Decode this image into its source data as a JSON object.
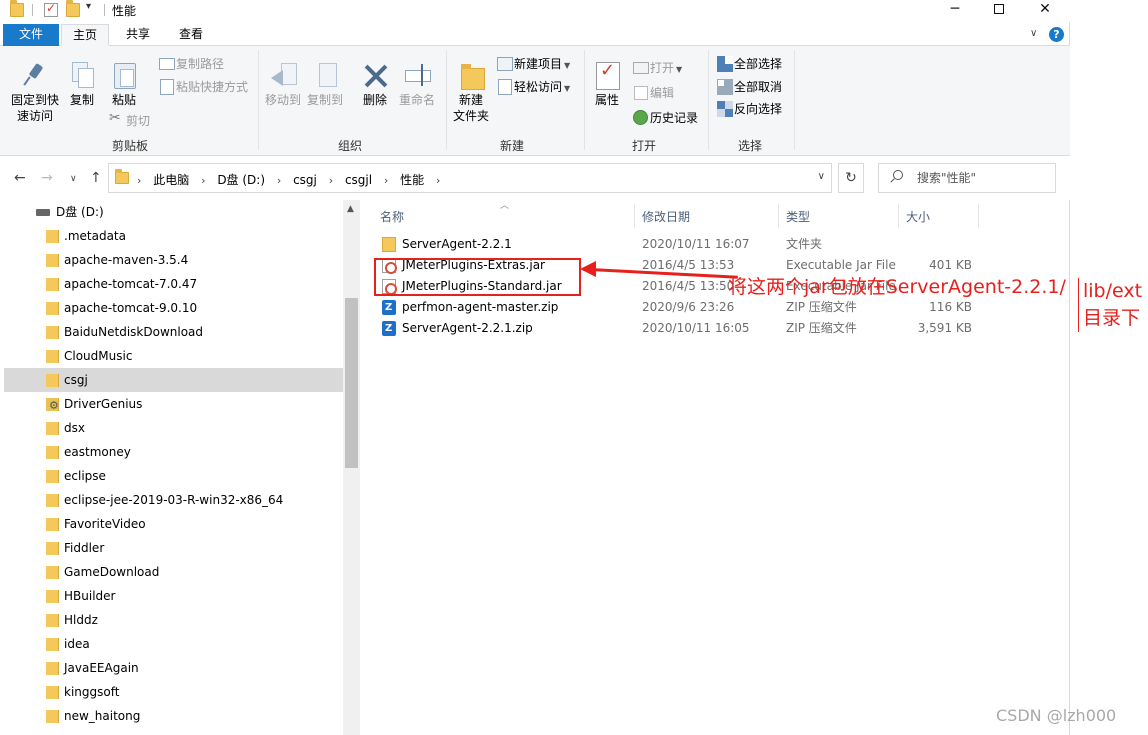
{
  "window": {
    "title": "性能",
    "controls": {
      "minimize": "─",
      "close": "✕"
    }
  },
  "tabs": {
    "file": "文件",
    "home": "主页",
    "share": "共享",
    "view": "查看"
  },
  "ribbon": {
    "pin": "固定到快\n速访问",
    "copy": "复制",
    "paste": "粘贴",
    "copy_path": "复制路径",
    "paste_shortcut": "粘贴快捷方式",
    "cut": "剪切",
    "clipboard_label": "剪贴板",
    "move_to": "移动到",
    "copy_to": "复制到",
    "delete": "删除",
    "rename": "重命名",
    "organize_label": "组织",
    "new_folder": "新建\n文件夹",
    "new_item": "新建项目",
    "easy_access": "轻松访问",
    "new_label": "新建",
    "properties": "属性",
    "open": "打开",
    "edit": "编辑",
    "history": "历史记录",
    "open_label": "打开",
    "select_all": "全部选择",
    "select_none": "全部取消",
    "invert_selection": "反向选择",
    "select_label": "选择"
  },
  "address": {
    "crumbs": [
      "此电脑",
      "D盘 (D:)",
      "csgj",
      "csgjl",
      "性能"
    ],
    "search_placeholder": "搜索\"性能\""
  },
  "navpane": {
    "drive": "D盘 (D:)",
    "items": [
      ".metadata",
      "apache-maven-3.5.4",
      "apache-tomcat-7.0.47",
      "apache-tomcat-9.0.10",
      "BaiduNetdiskDownload",
      "CloudMusic",
      "csgj",
      "DriverGenius",
      "dsx",
      "eastmoney",
      "eclipse",
      "eclipse-jee-2019-03-R-win32-x86_64",
      "FavoriteVideo",
      "Fiddler",
      "GameDownload",
      "HBuilder",
      "Hlddz",
      "idea",
      "JavaEEAgain",
      "kinggsoft",
      "new_haitong"
    ],
    "selected": "csgj"
  },
  "filelist": {
    "columns": {
      "name": "名称",
      "date": "修改日期",
      "type": "类型",
      "size": "大小"
    },
    "rows": [
      {
        "name": "ServerAgent-2.2.1",
        "date": "2020/10/11 16:07",
        "type": "文件夹",
        "size": "",
        "icon": "folder-icon"
      },
      {
        "name": "JMeterPlugins-Extras.jar",
        "date": "2016/4/5 13:53",
        "type": "Executable Jar File",
        "size": "401 KB",
        "icon": "jar-icon"
      },
      {
        "name": "JMeterPlugins-Standard.jar",
        "date": "2016/4/5 13:50",
        "type": "Executable Jar File",
        "size": "",
        "icon": "jar-icon"
      },
      {
        "name": "perfmon-agent-master.zip",
        "date": "2020/9/6 23:26",
        "type": "ZIP 压缩文件",
        "size": "116 KB",
        "icon": "zip-icon"
      },
      {
        "name": "ServerAgent-2.2.1.zip",
        "date": "2020/10/11 16:05",
        "type": "ZIP 压缩文件",
        "size": "3,591 KB",
        "icon": "zip-icon"
      }
    ]
  },
  "annotation": {
    "main": "将这两个jar包放在ServerAgent-2.2.1/",
    "side": "lib/ext目录下",
    "color": "#e8201d"
  },
  "watermark": "CSDN @lzh000"
}
